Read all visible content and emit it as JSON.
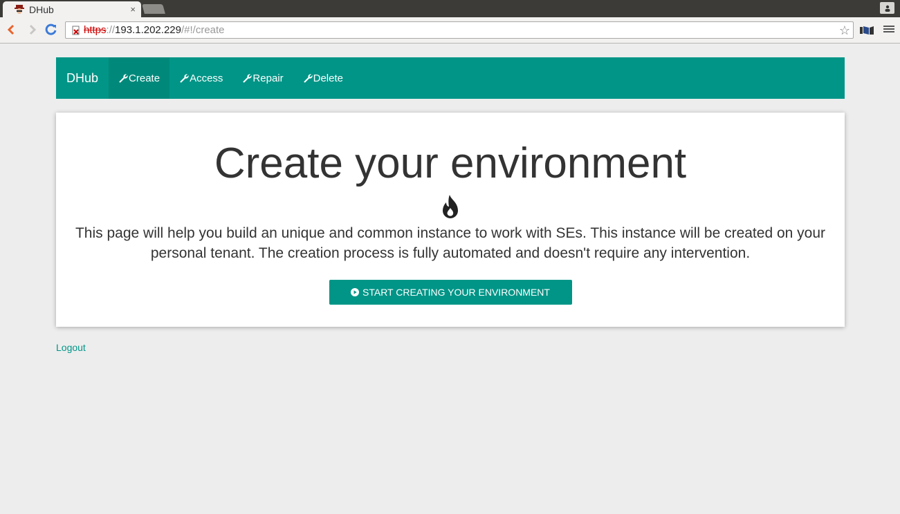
{
  "browser": {
    "tab_title": "DHub",
    "tab_close": "×",
    "url_scheme": "https",
    "url_host": "193.1.202.229",
    "url_path": "/#!/create",
    "star": "☆"
  },
  "navbar": {
    "brand": "DHub",
    "items": [
      {
        "label": "Create",
        "active": true
      },
      {
        "label": "Access",
        "active": false
      },
      {
        "label": "Repair",
        "active": false
      },
      {
        "label": "Delete",
        "active": false
      }
    ]
  },
  "main": {
    "title": "Create your environment",
    "description": "This page will help you build an unique and common instance to work with SEs. This instance will be created on your personal tenant. The creation process is fully automated and doesn't require any intervention.",
    "start_button": "START CREATING YOUR ENVIRONMENT"
  },
  "footer": {
    "logout": "Logout"
  },
  "colors": {
    "accent": "#009587",
    "accent_active": "#00897b",
    "background": "#ededed"
  },
  "icons": [
    "wrench-icon",
    "flame-icon",
    "play-circle-icon",
    "star-icon",
    "back-icon",
    "forward-icon",
    "reload-icon",
    "menu-icon"
  ]
}
